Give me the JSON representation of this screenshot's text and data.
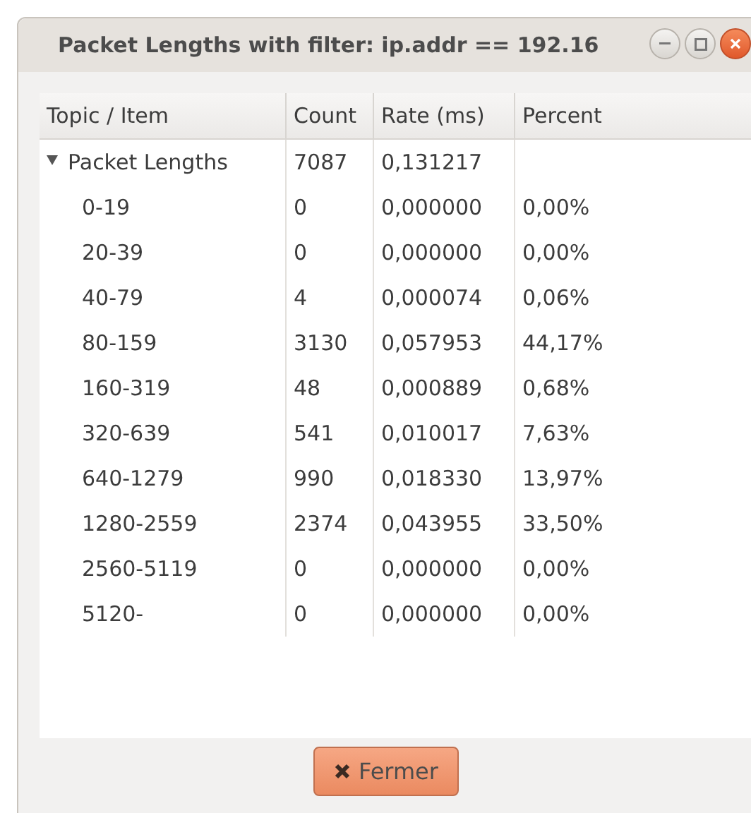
{
  "window": {
    "title": "Packet Lengths with filter: ip.addr == 192.16"
  },
  "table": {
    "columns": [
      "Topic / Item",
      "Count",
      "Rate (ms)",
      "Percent"
    ],
    "rows": [
      {
        "item": "Packet Lengths",
        "count": "7087",
        "rate": "0,131217",
        "expanded": true,
        "children": [
          {
            "item": "0-19",
            "count": "0",
            "rate": "0,000000",
            "percent": "0,00%"
          },
          {
            "item": "20-39",
            "count": "0",
            "rate": "0,000000",
            "percent": "0,00%"
          },
          {
            "item": "40-79",
            "count": "4",
            "rate": "0,000074",
            "percent": "0,06%"
          },
          {
            "item": "80-159",
            "count": "3130",
            "rate": "0,057953",
            "percent": "44,17%"
          },
          {
            "item": "160-319",
            "count": "48",
            "rate": "0,000889",
            "percent": "0,68%"
          },
          {
            "item": "320-639",
            "count": "541",
            "rate": "0,010017",
            "percent": "7,63%"
          },
          {
            "item": "640-1279",
            "count": "990",
            "rate": "0,018330",
            "percent": "13,97%"
          },
          {
            "item": "1280-2559",
            "count": "2374",
            "rate": "0,043955",
            "percent": "33,50%"
          },
          {
            "item": "2560-5119",
            "count": "0",
            "rate": "0,000000",
            "percent": "0,00%"
          },
          {
            "item": "5120-",
            "count": "0",
            "rate": "0,000000",
            "percent": "0,00%"
          }
        ]
      }
    ]
  },
  "buttons": [
    {
      "label": "Fermer"
    }
  ]
}
